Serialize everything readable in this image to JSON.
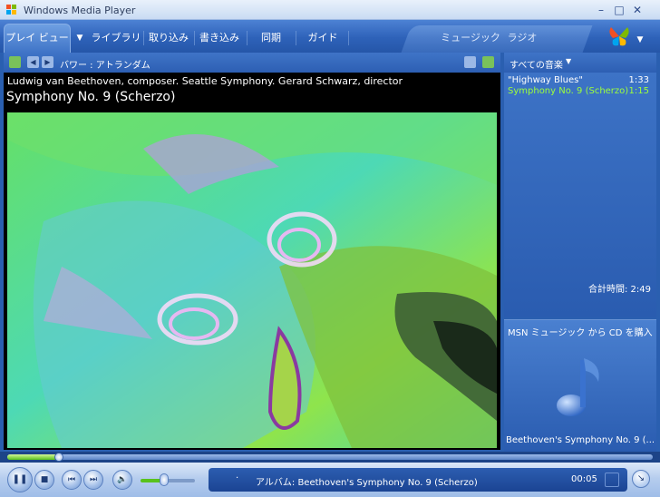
{
  "window": {
    "title": "Windows Media Player",
    "controls": [
      "–",
      "□",
      "✕"
    ]
  },
  "tabs": [
    {
      "label": "プレイ ビュー",
      "active": true
    },
    {
      "label": "ライブラリ"
    },
    {
      "label": "取り込み"
    },
    {
      "label": "書き込み"
    },
    {
      "label": "同期"
    },
    {
      "label": "ガイド"
    },
    {
      "label": "ミュージック"
    },
    {
      "label": "ラジオ"
    }
  ],
  "visualization": {
    "label": "バワー : アトランダム",
    "artist_line": "Ludwig van Beethoven, composer. Seattle Symphony. Gerard Schwarz, director",
    "track_title": "Symphony No. 9 (Scherzo)"
  },
  "playlist": {
    "header": "すべての音楽",
    "items": [
      {
        "title": "\"Highway Blues\"",
        "duration": "1:33",
        "color": "#ffffff"
      },
      {
        "title": "Symphony No. 9 (Scherzo)",
        "duration": "1:15",
        "color": "#9dff3b"
      }
    ],
    "total": "合計時間: 2:49"
  },
  "buy": {
    "label": "MSN ミュージック から CD を購入",
    "album": "Beethoven's Symphony No. 9 (..."
  },
  "player": {
    "status": "アルバム: Beethoven's Symphony No. 9 (Scherzo)",
    "time": "00:05",
    "seek_progress_pct": 8,
    "volume_pct": 45
  },
  "colors": {
    "accent": "#2556a8",
    "playing": "#9dff3b"
  }
}
